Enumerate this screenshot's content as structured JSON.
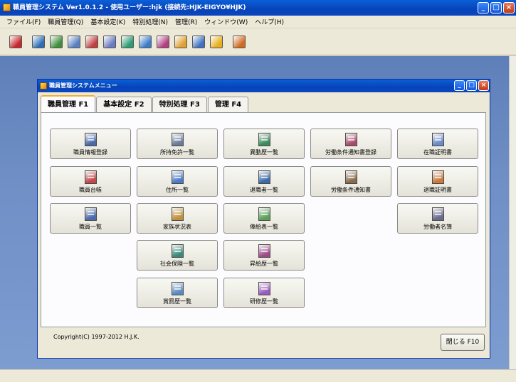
{
  "app": {
    "title": "職員管理システム Ver1.0.1.2 - 使用ユーザー:hjk (接続先:HJK-EIGYO¥HJK)"
  },
  "menubar": {
    "items": [
      "ファイル(F)",
      "職員管理(Q)",
      "基本設定(K)",
      "特別処理(N)",
      "管理(R)",
      "ウィンドウ(W)",
      "ヘルプ(H)"
    ]
  },
  "toolbar": {
    "icons": [
      "exit-icon",
      "staff-register-icon",
      "staff-ledger-icon",
      "staff-list-icon",
      "license-list-icon",
      "address-list-icon",
      "family-icon",
      "social-insurance-icon",
      "reward-icon",
      "transfer-icon",
      "retiree-icon",
      "key-icon",
      "calendar-icon"
    ],
    "colors": [
      "#c8262a",
      "#2f6db5",
      "#3f8f3a",
      "#5a7fc0",
      "#c04040",
      "#6b7bbf",
      "#2f9b73",
      "#3c7cc8",
      "#b04080",
      "#e0a030",
      "#4070c0",
      "#e8b020",
      "#d06a20"
    ]
  },
  "child_window": {
    "title": "職員管理システムメニュー",
    "tabs": [
      {
        "label": "職員管理 F1",
        "active": true
      },
      {
        "label": "基本設定 F2",
        "active": false
      },
      {
        "label": "特別処理 F3",
        "active": false
      },
      {
        "label": "管理 F4",
        "active": false
      }
    ],
    "buttons": [
      {
        "label": "職員情報登録",
        "icon": "staff-info-icon",
        "color": "#4a6aa8"
      },
      {
        "label": "所持免許一覧",
        "icon": "license-icon",
        "color": "#6a7a9a"
      },
      {
        "label": "異動歴一覧",
        "icon": "transfer-history-icon",
        "color": "#3a8a5a"
      },
      {
        "label": "労働条件通知書登録",
        "icon": "contract-register-icon",
        "color": "#a84a6a"
      },
      {
        "label": "在職証明書",
        "icon": "employment-cert-icon",
        "color": "#6a8ac8"
      },
      {
        "label": "職員台帳",
        "icon": "staff-ledger-icon",
        "color": "#c04848"
      },
      {
        "label": "住所一覧",
        "icon": "address-icon",
        "color": "#4a7ac8"
      },
      {
        "label": "退職者一覧",
        "icon": "retiree-icon",
        "color": "#3a6aa8"
      },
      {
        "label": "労働条件通知書",
        "icon": "contract-icon",
        "color": "#8a6a4a"
      },
      {
        "label": "退職証明書",
        "icon": "retirement-cert-icon",
        "color": "#c87a3a"
      },
      {
        "label": "職員一覧",
        "icon": "staff-list-icon",
        "color": "#4a6aa8"
      },
      {
        "label": "家族状況表",
        "icon": "family-icon",
        "color": "#c0903a"
      },
      {
        "label": "俸給表一覧",
        "icon": "salary-table-icon",
        "color": "#5aa05a"
      },
      {
        "label": "労働者名簿",
        "icon": "worker-roster-icon",
        "color": "#6a6a8a"
      },
      {
        "label": "社会保険一覧",
        "icon": "social-insurance-icon",
        "color": "#3a8a7a"
      },
      {
        "label": "昇給歴一覧",
        "icon": "pay-raise-icon",
        "color": "#a04a8a"
      },
      {
        "label": "賞罰歴一覧",
        "icon": "award-icon",
        "color": "#5a8ac0"
      },
      {
        "label": "研修歴一覧",
        "icon": "training-icon",
        "color": "#9a5ac0"
      }
    ],
    "copyright": "Copyright(C) 1997-2012 H.J.K.",
    "close_label": "閉じる F10"
  }
}
